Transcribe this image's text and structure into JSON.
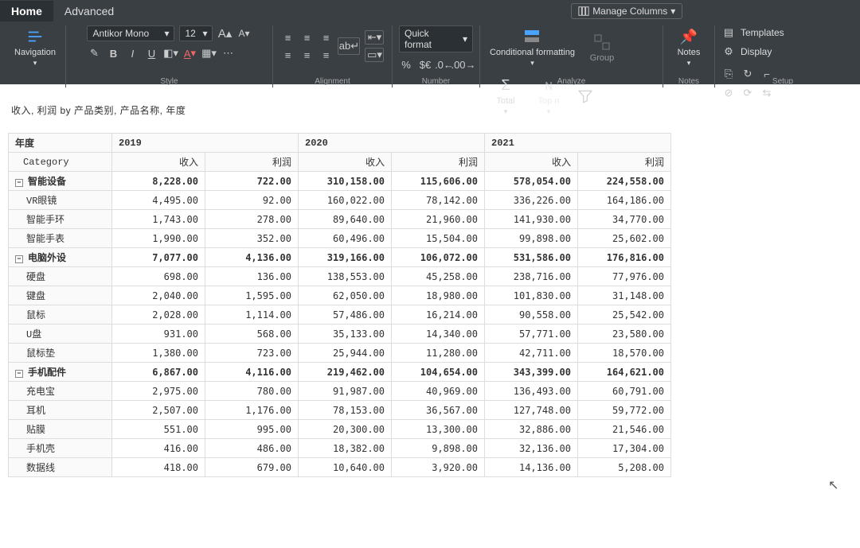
{
  "tabs": {
    "home": "Home",
    "advanced": "Advanced"
  },
  "manage_columns": "Manage Columns",
  "ribbon": {
    "navigation": "Navigation",
    "font_family": "Antikor Mono",
    "font_size": "12",
    "quick_format": "Quick format",
    "conditional_formatting": "Conditional formatting",
    "group": "Group",
    "total": "Total",
    "topn": "Top n",
    "notes": "Notes",
    "templates": "Templates",
    "display": "Display",
    "labels": {
      "style": "Style",
      "alignment": "Alignment",
      "number": "Number",
      "analyze": "Analyze",
      "notes": "Notes",
      "setup": "Setup"
    }
  },
  "report": {
    "title": "收入, 利润 by 产品类别, 产品名称, 年度",
    "colhead_year": "年度",
    "colhead_category": "Category",
    "years": [
      "2019",
      "2020",
      "2021"
    ],
    "measures": [
      "收入",
      "利润"
    ],
    "groups": [
      {
        "name": "智能设备",
        "totals": [
          "8,228.00",
          "722.00",
          "310,158.00",
          "115,606.00",
          "578,054.00",
          "224,558.00"
        ],
        "rows": [
          {
            "name": "VR眼镜",
            "vals": [
              "4,495.00",
              "92.00",
              "160,022.00",
              "78,142.00",
              "336,226.00",
              "164,186.00"
            ]
          },
          {
            "name": "智能手环",
            "vals": [
              "1,743.00",
              "278.00",
              "89,640.00",
              "21,960.00",
              "141,930.00",
              "34,770.00"
            ]
          },
          {
            "name": "智能手表",
            "vals": [
              "1,990.00",
              "352.00",
              "60,496.00",
              "15,504.00",
              "99,898.00",
              "25,602.00"
            ]
          }
        ]
      },
      {
        "name": "电脑外设",
        "totals": [
          "7,077.00",
          "4,136.00",
          "319,166.00",
          "106,072.00",
          "531,586.00",
          "176,816.00"
        ],
        "rows": [
          {
            "name": "硬盘",
            "vals": [
              "698.00",
              "136.00",
              "138,553.00",
              "45,258.00",
              "238,716.00",
              "77,976.00"
            ]
          },
          {
            "name": "键盘",
            "vals": [
              "2,040.00",
              "1,595.00",
              "62,050.00",
              "18,980.00",
              "101,830.00",
              "31,148.00"
            ]
          },
          {
            "name": "鼠标",
            "vals": [
              "2,028.00",
              "1,114.00",
              "57,486.00",
              "16,214.00",
              "90,558.00",
              "25,542.00"
            ]
          },
          {
            "name": "U盘",
            "vals": [
              "931.00",
              "568.00",
              "35,133.00",
              "14,340.00",
              "57,771.00",
              "23,580.00"
            ]
          },
          {
            "name": "鼠标垫",
            "vals": [
              "1,380.00",
              "723.00",
              "25,944.00",
              "11,280.00",
              "42,711.00",
              "18,570.00"
            ]
          }
        ]
      },
      {
        "name": "手机配件",
        "totals": [
          "6,867.00",
          "4,116.00",
          "219,462.00",
          "104,654.00",
          "343,399.00",
          "164,621.00"
        ],
        "rows": [
          {
            "name": "充电宝",
            "vals": [
              "2,975.00",
              "780.00",
              "91,987.00",
              "40,969.00",
              "136,493.00",
              "60,791.00"
            ]
          },
          {
            "name": "耳机",
            "vals": [
              "2,507.00",
              "1,176.00",
              "78,153.00",
              "36,567.00",
              "127,748.00",
              "59,772.00"
            ]
          },
          {
            "name": "贴膜",
            "vals": [
              "551.00",
              "995.00",
              "20,300.00",
              "13,300.00",
              "32,886.00",
              "21,546.00"
            ]
          },
          {
            "name": "手机壳",
            "vals": [
              "416.00",
              "486.00",
              "18,382.00",
              "9,898.00",
              "32,136.00",
              "17,304.00"
            ]
          },
          {
            "name": "数据线",
            "vals": [
              "418.00",
              "679.00",
              "10,640.00",
              "3,920.00",
              "14,136.00",
              "5,208.00"
            ]
          }
        ]
      }
    ]
  }
}
